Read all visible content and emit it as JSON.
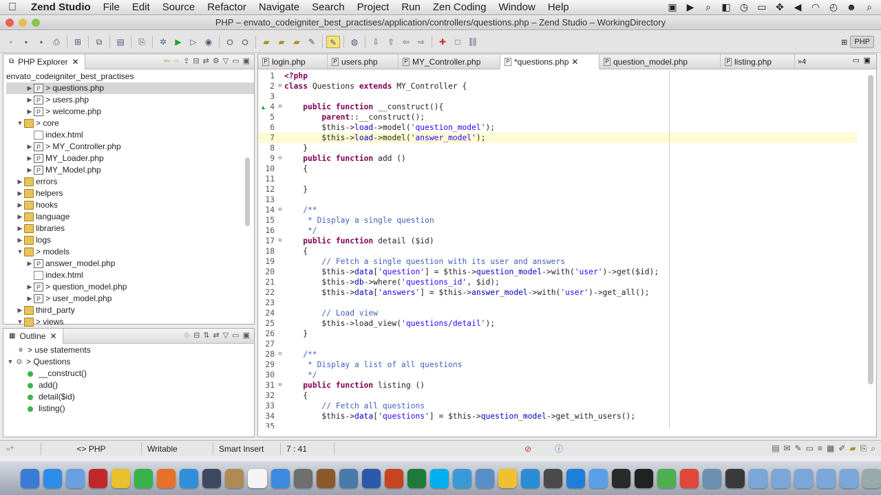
{
  "menubar": {
    "app_name": "Zend Studio",
    "items": [
      "File",
      "Edit",
      "Source",
      "Refactor",
      "Navigate",
      "Search",
      "Project",
      "Run",
      "Zen Coding",
      "Window",
      "Help"
    ],
    "tray_icons": [
      "camera-icon",
      "play-icon",
      "search-icon",
      "ui-icon",
      "timemachine-icon",
      "display-icon",
      "move-icon",
      "volume-icon",
      "wifi-icon",
      "clock-icon",
      "user-icon",
      "spotlight-icon"
    ]
  },
  "window": {
    "title": "PHP – envato_codeigniter_best_practises/application/controllers/questions.php – Zend Studio – WorkingDirectory",
    "perspective": "PHP"
  },
  "explorer": {
    "title": "PHP Explorer",
    "project": "envato_codeigniter_best_practises",
    "items": [
      {
        "label": "> questions.php",
        "type": "php",
        "indent": 2,
        "twisty": "closed",
        "selected": true
      },
      {
        "label": "> users.php",
        "type": "php",
        "indent": 2,
        "twisty": "closed"
      },
      {
        "label": "> welcome.php",
        "type": "php",
        "indent": 2,
        "twisty": "closed"
      },
      {
        "label": "> core",
        "type": "folder",
        "indent": 1,
        "twisty": "open"
      },
      {
        "label": "index.html",
        "type": "file",
        "indent": 2,
        "twisty": ""
      },
      {
        "label": "> MY_Controller.php",
        "type": "php",
        "indent": 2,
        "twisty": "closed"
      },
      {
        "label": "MY_Loader.php",
        "type": "php",
        "indent": 2,
        "twisty": "closed"
      },
      {
        "label": "MY_Model.php",
        "type": "php",
        "indent": 2,
        "twisty": "closed"
      },
      {
        "label": "errors",
        "type": "folder",
        "indent": 1,
        "twisty": "closed"
      },
      {
        "label": "helpers",
        "type": "folder",
        "indent": 1,
        "twisty": "closed"
      },
      {
        "label": "hooks",
        "type": "folder",
        "indent": 1,
        "twisty": "closed"
      },
      {
        "label": "language",
        "type": "folder",
        "indent": 1,
        "twisty": "closed"
      },
      {
        "label": "libraries",
        "type": "folder",
        "indent": 1,
        "twisty": "closed"
      },
      {
        "label": "logs",
        "type": "folder",
        "indent": 1,
        "twisty": "closed"
      },
      {
        "label": "> models",
        "type": "folder",
        "indent": 1,
        "twisty": "open"
      },
      {
        "label": "answer_model.php",
        "type": "php",
        "indent": 2,
        "twisty": "closed"
      },
      {
        "label": "index.html",
        "type": "file",
        "indent": 2,
        "twisty": ""
      },
      {
        "label": "> question_model.php",
        "type": "php",
        "indent": 2,
        "twisty": "closed"
      },
      {
        "label": "> user_model.php",
        "type": "php",
        "indent": 2,
        "twisty": "closed"
      },
      {
        "label": "third_party",
        "type": "folder",
        "indent": 1,
        "twisty": "closed"
      },
      {
        "label": "> views",
        "type": "folder",
        "indent": 1,
        "twisty": "open"
      }
    ]
  },
  "outline": {
    "title": "Outline",
    "items": [
      {
        "label": "> use statements",
        "type": "use",
        "indent": 1
      },
      {
        "label": "> Questions",
        "type": "class",
        "indent": 0
      },
      {
        "label": "__construct()",
        "type": "method",
        "indent": 2
      },
      {
        "label": "add()",
        "type": "method",
        "indent": 2
      },
      {
        "label": "detail($id)",
        "type": "method",
        "indent": 2
      },
      {
        "label": "listing()",
        "type": "method",
        "indent": 2
      }
    ]
  },
  "editor": {
    "tabs": [
      {
        "label": "login.php",
        "active": false,
        "close": false
      },
      {
        "label": "users.php",
        "active": false,
        "close": false
      },
      {
        "label": "MY_Controller.php",
        "active": false,
        "close": false
      },
      {
        "label": "*questions.php",
        "active": true,
        "close": true
      },
      {
        "label": "question_model.php",
        "active": false,
        "close": false
      },
      {
        "label": "listing.php",
        "active": false,
        "close": false
      }
    ],
    "overflow": "»4",
    "current_line": 7,
    "lines": [
      {
        "n": "1",
        "t": [
          [
            "kw",
            "<?php"
          ]
        ]
      },
      {
        "n": "2",
        "f": "⊖",
        "t": [
          [
            "kw",
            "class "
          ],
          [
            "",
            "Questions "
          ],
          [
            "kw",
            "extends "
          ],
          [
            "",
            "MY_Controller {"
          ]
        ]
      },
      {
        "n": "3",
        "t": []
      },
      {
        "n": "4",
        "f": "⊖",
        "t": [
          [
            "",
            "    "
          ],
          [
            "kw",
            "public function "
          ],
          [
            "",
            "__construct(){"
          ]
        ]
      },
      {
        "n": "5",
        "t": [
          [
            "",
            "        "
          ],
          [
            "kw",
            "parent"
          ],
          [
            "",
            "::__construct();"
          ]
        ]
      },
      {
        "n": "6",
        "t": [
          [
            "",
            "        $this->"
          ],
          [
            "prop",
            "load"
          ],
          [
            "",
            "->model("
          ],
          [
            "str",
            "'question_model'"
          ],
          [
            "",
            ");"
          ]
        ]
      },
      {
        "n": "7",
        "t": [
          [
            "",
            "        $this->"
          ],
          [
            "prop",
            "load"
          ],
          [
            "",
            "->model("
          ],
          [
            "str",
            "'answer_model'"
          ],
          [
            "",
            ");"
          ]
        ]
      },
      {
        "n": "8",
        "t": [
          [
            "",
            "    }"
          ]
        ]
      },
      {
        "n": "9",
        "f": "⊖",
        "t": [
          [
            "",
            "    "
          ],
          [
            "kw",
            "public function "
          ],
          [
            "",
            "add ()"
          ]
        ]
      },
      {
        "n": "10",
        "t": [
          [
            "",
            "    {"
          ]
        ]
      },
      {
        "n": "11",
        "t": []
      },
      {
        "n": "12",
        "t": [
          [
            "",
            "    }"
          ]
        ]
      },
      {
        "n": "13",
        "t": []
      },
      {
        "n": "14",
        "f": "⊖",
        "t": [
          [
            "cm",
            "    /**"
          ]
        ]
      },
      {
        "n": "15",
        "t": [
          [
            "cm",
            "     * Display a single question"
          ]
        ]
      },
      {
        "n": "16",
        "t": [
          [
            "cm",
            "     */"
          ]
        ]
      },
      {
        "n": "17",
        "f": "⊖",
        "t": [
          [
            "",
            "    "
          ],
          [
            "kw",
            "public function "
          ],
          [
            "",
            "detail ($id)"
          ]
        ]
      },
      {
        "n": "18",
        "t": [
          [
            "",
            "    {"
          ]
        ]
      },
      {
        "n": "19",
        "t": [
          [
            "cm",
            "        // Fetch a single question with its user and answers"
          ]
        ]
      },
      {
        "n": "20",
        "t": [
          [
            "",
            "        $this->"
          ],
          [
            "prop",
            "data"
          ],
          [
            "",
            "["
          ],
          [
            "str",
            "'question'"
          ],
          [
            "",
            "] = $this->"
          ],
          [
            "prop",
            "question_model"
          ],
          [
            "",
            "->with("
          ],
          [
            "str",
            "'user'"
          ],
          [
            "",
            ")->get($id);"
          ]
        ]
      },
      {
        "n": "21",
        "t": [
          [
            "",
            "        $this->"
          ],
          [
            "prop",
            "db"
          ],
          [
            "",
            "->where("
          ],
          [
            "str",
            "'questions_id'"
          ],
          [
            "",
            ", $id);"
          ]
        ]
      },
      {
        "n": "22",
        "t": [
          [
            "",
            "        $this->"
          ],
          [
            "prop",
            "data"
          ],
          [
            "",
            "["
          ],
          [
            "str",
            "'answers'"
          ],
          [
            "",
            "] = $this->"
          ],
          [
            "prop",
            "answer_model"
          ],
          [
            "",
            "->with("
          ],
          [
            "str",
            "'user'"
          ],
          [
            "",
            ")->get_all();"
          ]
        ]
      },
      {
        "n": "23",
        "t": []
      },
      {
        "n": "24",
        "t": [
          [
            "cm",
            "        // Load view"
          ]
        ]
      },
      {
        "n": "25",
        "t": [
          [
            "",
            "        $this->load_view("
          ],
          [
            "str",
            "'questions/detail'"
          ],
          [
            "",
            ");"
          ]
        ]
      },
      {
        "n": "26",
        "t": [
          [
            "",
            "    }"
          ]
        ]
      },
      {
        "n": "27",
        "t": []
      },
      {
        "n": "28",
        "f": "⊖",
        "t": [
          [
            "cm",
            "    /**"
          ]
        ]
      },
      {
        "n": "29",
        "t": [
          [
            "cm",
            "     * Display a list of all questions"
          ]
        ]
      },
      {
        "n": "30",
        "t": [
          [
            "cm",
            "     */"
          ]
        ]
      },
      {
        "n": "31",
        "f": "⊖",
        "t": [
          [
            "",
            "    "
          ],
          [
            "kw",
            "public function "
          ],
          [
            "",
            "listing ()"
          ]
        ]
      },
      {
        "n": "32",
        "t": [
          [
            "",
            "    {"
          ]
        ]
      },
      {
        "n": "33",
        "t": [
          [
            "cm",
            "        // Fetch all questions"
          ]
        ]
      },
      {
        "n": "34",
        "t": [
          [
            "",
            "        $this->"
          ],
          [
            "prop",
            "data"
          ],
          [
            "",
            "["
          ],
          [
            "str",
            "'questions'"
          ],
          [
            "",
            "] = $this->"
          ],
          [
            "prop",
            "question_model"
          ],
          [
            "",
            "->get_with_users();"
          ]
        ]
      },
      {
        "n": "35",
        "t": []
      }
    ]
  },
  "status": {
    "language": "PHP",
    "mode": "Writable",
    "insert": "Smart Insert",
    "position": "7 : 41"
  },
  "dock": [
    "finder-icon",
    "appstore-icon",
    "preview-icon",
    "flashcards-icon",
    "fireworks-icon",
    "chrome-green-icon",
    "firefox-icon",
    "safari-icon",
    "camera-icon",
    "contacts-icon",
    "calendar-icon",
    "itunes-icon",
    "systemprefs-icon",
    "photos-icon",
    "imagecapture-icon",
    "word-icon",
    "powerpoint-icon",
    "excel-icon",
    "skype-icon",
    "tweetie-icon",
    "cyberduck-icon",
    "adium-icon",
    "ie-icon",
    "claquette-icon",
    "teamviewer-icon",
    "target-icon",
    "activity-icon",
    "dashboard-icon",
    "evernote-icon",
    "chrome-icon",
    "textwrangler-icon",
    "sublime-icon",
    "folder-icon",
    "folder-icon-2",
    "folder-icon-3",
    "folder-icon-4",
    "folder-icon-5",
    "trash-icon"
  ]
}
